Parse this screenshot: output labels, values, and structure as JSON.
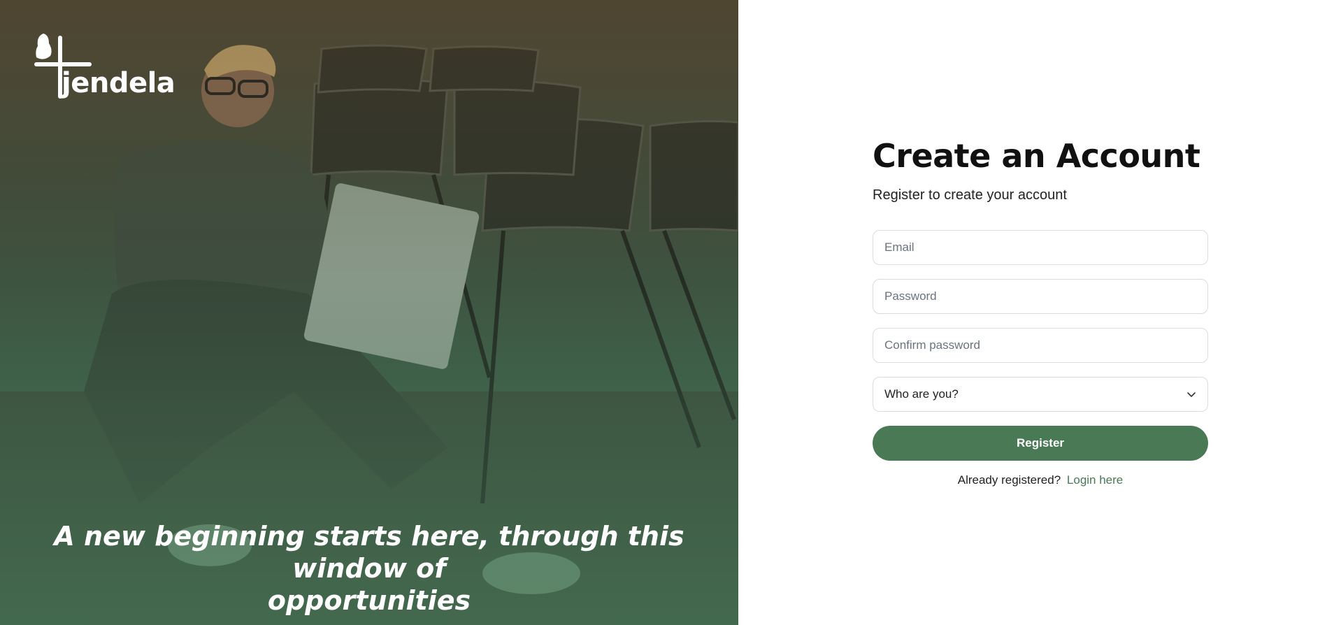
{
  "brand": {
    "name": "jendela",
    "accent": "#4a7a55"
  },
  "hero": {
    "tagline_line1": "A new beginning starts here, through this window of",
    "tagline_line2": "opportunities"
  },
  "form": {
    "title": "Create an Account",
    "subtitle": "Register to create your account",
    "email": {
      "placeholder": "Email",
      "value": ""
    },
    "password": {
      "placeholder": "Password",
      "value": ""
    },
    "confirm_password": {
      "placeholder": "Confirm password",
      "value": ""
    },
    "role_select": {
      "selected": "Who are you?"
    },
    "register_label": "Register",
    "login_prompt": "Already registered?",
    "login_link": "Login here"
  },
  "icons": {
    "select_chevron": "chevron-down-icon"
  }
}
